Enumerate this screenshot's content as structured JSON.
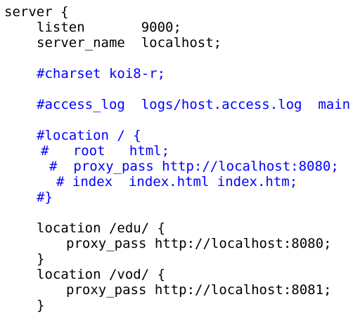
{
  "editor": {
    "text_color": "#000000",
    "comment_color": "#0000ff",
    "background_color": "#ffffff",
    "lines": [
      {
        "text": "server {",
        "kind": "code"
      },
      {
        "text": "listen       9000;",
        "kind": "code"
      },
      {
        "text": "server_name  localhost;",
        "kind": "code"
      },
      {
        "text": "#charset koi8-r;",
        "kind": "comment"
      },
      {
        "text": "#access_log  logs/host.access.log  main;",
        "kind": "comment"
      },
      {
        "text": "#location / {",
        "kind": "comment"
      },
      {
        "text": "#   root   html;",
        "kind": "comment"
      },
      {
        "text": "#  proxy_pass http://localhost:8080;",
        "kind": "comment"
      },
      {
        "text": "# index  index.html index.htm;",
        "kind": "comment"
      },
      {
        "text": "#}",
        "kind": "comment"
      },
      {
        "text": "location /edu/ {",
        "kind": "code"
      },
      {
        "text": "proxy_pass http://localhost:8080;",
        "kind": "code"
      },
      {
        "text": "}",
        "kind": "code"
      },
      {
        "text": "location /vod/ {",
        "kind": "code"
      },
      {
        "text": "proxy_pass http://localhost:8081;",
        "kind": "code"
      },
      {
        "text": "}",
        "kind": "code"
      }
    ]
  }
}
